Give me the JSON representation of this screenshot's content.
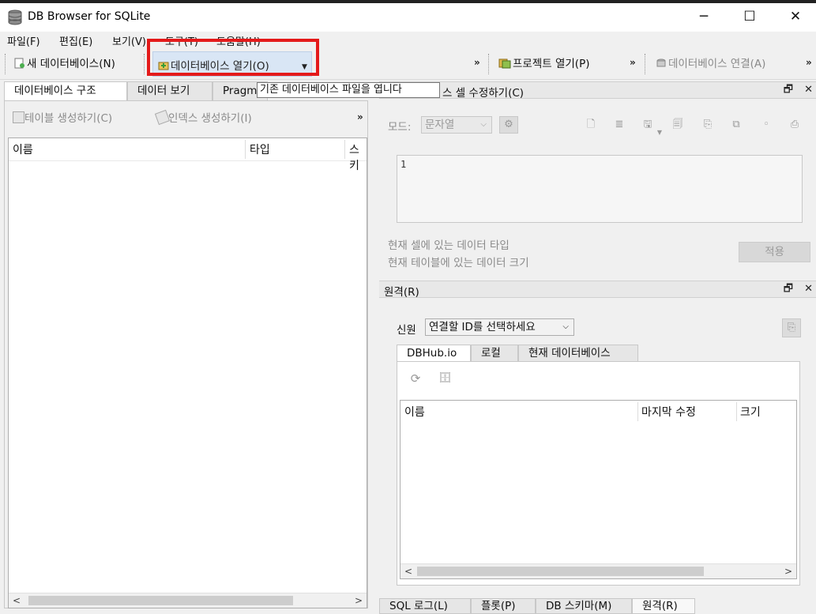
{
  "window": {
    "title": "DB Browser for SQLite",
    "minimize": "─",
    "maximize": "☐",
    "close": "✕"
  },
  "menu": [
    {
      "label": "파일(F)"
    },
    {
      "label": "편집(E)"
    },
    {
      "label": "보기(V)"
    },
    {
      "label": "도구(T)"
    },
    {
      "label": "도움말(H)"
    }
  ],
  "toolbar": {
    "new_db": "새 데이터베이스(N)",
    "open_db": "데이터베이스 열기(O)",
    "open_project": "프로젝트 열기(P)",
    "attach_db": "데이터베이스 연결(A)",
    "overflow": "»"
  },
  "tooltip": "기존 데이터베이스 파일을 엽니다",
  "left": {
    "tabs": [
      {
        "label": "데이터베이스 구조",
        "active": true
      },
      {
        "label": "데이터 보기",
        "active": false
      },
      {
        "label": "Pragm",
        "active": false
      }
    ],
    "create_table": "테이블 생성하기(C)",
    "create_index": "인덱스 생성하기(I)",
    "overflow": "»",
    "columns": [
      "이름",
      "타입",
      "스키"
    ]
  },
  "edit_cell": {
    "title": "데이터베이스 셀 수정하기(C)",
    "title_visible": "스 셀 수정하기(C)",
    "mode_label": "모드:",
    "mode_value": "문자열",
    "content": "1",
    "type_info": "현재 셀에 있는 데이터 타입",
    "size_info": "현재 테이블에 있는 데이터 크기",
    "apply": "적용"
  },
  "remote": {
    "title": "원격(R)",
    "identity_label": "신원",
    "identity_value": "연결할 ID를 선택하세요",
    "tabs": [
      {
        "label": "DBHub.io",
        "active": true
      },
      {
        "label": "로컬",
        "active": false
      },
      {
        "label": "현재 데이터베이스",
        "active": false
      }
    ],
    "columns": [
      "이름",
      "마지막 수정",
      "크기"
    ]
  },
  "bottom_tabs": [
    {
      "label": "SQL 로그(L)"
    },
    {
      "label": "플롯(P)"
    },
    {
      "label": "DB 스키마(M)"
    },
    {
      "label": "원격(R)",
      "active": true
    }
  ],
  "dock_buttons": {
    "float": "🗗",
    "close": "✕"
  },
  "colors": {
    "highlight": "#e41a1a",
    "tooltip_bg": "#ffffff",
    "hover_bg": "#d9e6f5"
  }
}
